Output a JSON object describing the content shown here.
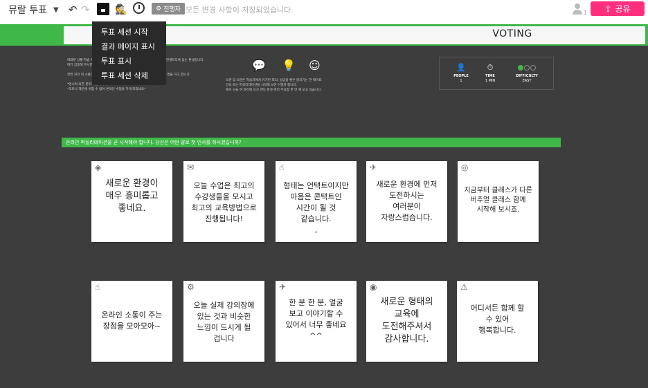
{
  "toolbar": {
    "app_title": "뮤랄 투표",
    "badge": "진행자",
    "saved_status": "모든 변경 사항이 저장되었습니다.",
    "user_count": "1",
    "share_label": "공유"
  },
  "menu": {
    "items": [
      "투표 세션 시작",
      "결과 페이지 표시",
      "투표 표시",
      "투표 세션 삭제"
    ]
  },
  "header": {
    "title": "VOTING"
  },
  "description": {
    "left": [
      "여대분 상황 학습 목적을 달성하기 위한 활동으로, 소통하여 좋은 생각들이 연결되도록 돕는 환설입니다.",
      "여기 집중해 주시면 좋겠습니다.",
      "한번 자리 위 소통하고 의견을 모으는 과정을 통해 더 좋은 아이디어 이르른 발을 하고 합니다.",
      "*명시적 의한 분위기 참여하세요",
      "*코로나 해문에 위험 수 없어 온라인 수업을 하게 되었네요*"
    ],
    "right": [
      "의견 및 의견은 학습자에게 유기된 회의, 방금을 좋은 알리기는 한 매이표",
      "강의 또는 퍼실리테이션을 시작해 보면 어떨까 합니다.",
      "해서 오늘 여 자리에 오신 멘도 분과 여러 주요함 한 번 해 보고 싶습니다."
    ]
  },
  "info": {
    "people_label": "PEOPLE",
    "people_value": "1",
    "time_label": "TIME",
    "time_value": "1 MIN",
    "difficulty_label": "DIFFICULTY",
    "difficulty_value": "EASY",
    "difficulty_level": 1,
    "difficulty_max": 3
  },
  "question": "온라인 퍼실리테이션을 곧 시작해야 합니다. 당신은 어떤 말로 첫 인사를 하시겠습니까?",
  "notes": [
    {
      "icon": "diamond-rings-icon",
      "glyph": "◈",
      "text": "새로운 환경이\n매우 흥미롭고\n좋네요."
    },
    {
      "icon": "envelope-icon",
      "glyph": "✉",
      "text": "오늘 수업은 최고의\n수강생들을 모시고\n최고의 교육방법으로\n진행됩니다!"
    },
    {
      "icon": "hand-icon",
      "glyph": "☝",
      "text": "형태는 언택트이지만\n마음은 콘택트인\n시간이 될 것\n같습니다.\n,"
    },
    {
      "icon": "rocket-icon",
      "glyph": "✈",
      "text": "새로운 환경에 먼저\n도전하시는\n여러분이\n자랑스럽습니다."
    },
    {
      "icon": "globe-icon",
      "glyph": "◎",
      "text": "지금부터 클래스가 다른\n버추얼 클래스 함께\n시작해 보시죠."
    },
    {
      "icon": "thumbs-up-icon",
      "glyph": "☝",
      "text": "온라인 소통이 주는\n장점을 모아모아~"
    },
    {
      "icon": "gear-icon",
      "glyph": "⚙",
      "text": "오늘 실제 강의장에\n있는 것과 비슷한\n느낌이 드시게 될\n겁니다"
    },
    {
      "icon": "airplane-icon",
      "glyph": "✈",
      "text": "한 분 한 분, 얼굴\n보고 이야기할 수\n있어서 너무 좋네요\n^^"
    },
    {
      "icon": "target-icon",
      "glyph": "◉",
      "text": "새로운 형태의\n교육에\n도전해주셔서\n감사합니다."
    },
    {
      "icon": "warning-icon",
      "glyph": "⚠",
      "text": "어디서든 함께 할\n수 있어\n행복합니다."
    }
  ]
}
